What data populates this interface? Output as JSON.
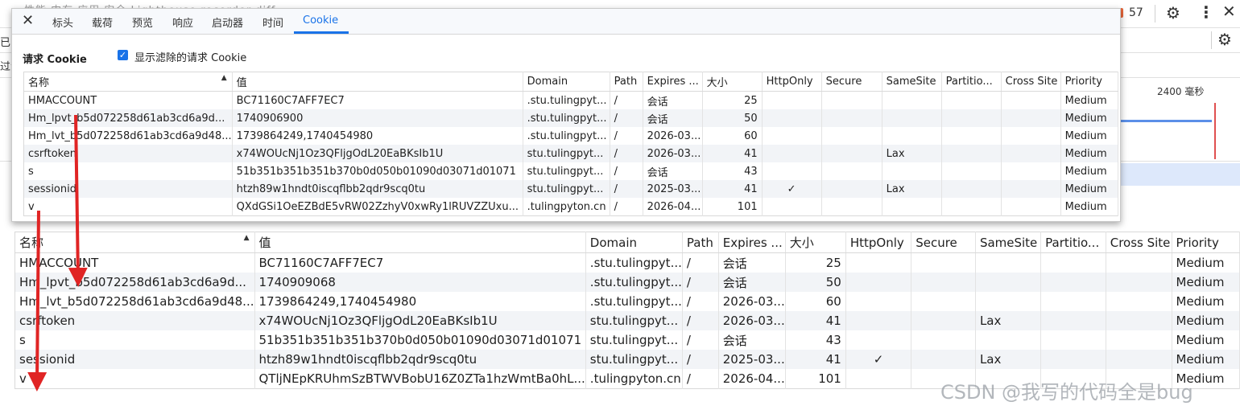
{
  "background": {
    "ghost_tabs": "性能   内存   应用   安全   Lighthouse   recorder   diff",
    "issue_count": "57",
    "row2_fragment": "已",
    "row3_fragment": "过滤",
    "timeline_label": "2400 毫秒"
  },
  "popup": {
    "tabs": [
      "标头",
      "载荷",
      "预览",
      "响应",
      "启动器",
      "时间",
      "Cookie"
    ],
    "active_tab": "Cookie",
    "section_title": "请求 Cookie",
    "checkbox_label": "显示滤除的请求 Cookie",
    "checkbox_checked": true,
    "columns": [
      "名称",
      "值",
      "Domain",
      "Path",
      "Expires ...",
      "大小",
      "HttpOnly",
      "Secure",
      "SameSite",
      "Partitio...",
      "Cross Site",
      "Priority"
    ],
    "rows": [
      {
        "name": "HMACCOUNT",
        "value": "BC71160C7AFF7EC7",
        "domain": ".stu.tulingpyt...",
        "path": "/",
        "expires": "会话",
        "size": "25",
        "httponly": "",
        "secure": "",
        "samesite": "",
        "partition": "",
        "cross_site": "",
        "priority": "Medium"
      },
      {
        "name": "Hm_lpvt_b5d072258d61ab3cd6a9d...",
        "value": "1740906900",
        "domain": ".stu.tulingpyt...",
        "path": "/",
        "expires": "会话",
        "size": "50",
        "httponly": "",
        "secure": "",
        "samesite": "",
        "partition": "",
        "cross_site": "",
        "priority": "Medium"
      },
      {
        "name": "Hm_lvt_b5d072258d61ab3cd6a9d48...",
        "value": "1739864249,1740454980",
        "domain": ".stu.tulingpyt...",
        "path": "/",
        "expires": "2026-03...",
        "size": "60",
        "httponly": "",
        "secure": "",
        "samesite": "",
        "partition": "",
        "cross_site": "",
        "priority": "Medium"
      },
      {
        "name": "csrftoken",
        "value": "x74WOUcNj1Oz3QFljgOdL20EaBKsIb1U",
        "domain": "stu.tulingpyt...",
        "path": "/",
        "expires": "2026-03...",
        "size": "41",
        "httponly": "",
        "secure": "",
        "samesite": "Lax",
        "partition": "",
        "cross_site": "",
        "priority": "Medium"
      },
      {
        "name": "s",
        "value": "51b351b351b351b370b0d050b01090d03071d01071",
        "domain": "stu.tulingpyt...",
        "path": "/",
        "expires": "会话",
        "size": "43",
        "httponly": "",
        "secure": "",
        "samesite": "",
        "partition": "",
        "cross_site": "",
        "priority": "Medium"
      },
      {
        "name": "sessionid",
        "value": "htzh89w1hndt0iscqflbb2qdr9scq0tu",
        "domain": "stu.tulingpyt...",
        "path": "/",
        "expires": "2025-03...",
        "size": "41",
        "httponly": "✓",
        "secure": "",
        "samesite": "Lax",
        "partition": "",
        "cross_site": "",
        "priority": "Medium"
      },
      {
        "name": "v",
        "value": "QXdGSi1OeEZBdE5vRW02ZzhyV0xwRy1lRUVZZUxu...",
        "domain": ".tulingpyton.cn",
        "path": "/",
        "expires": "2026-04...",
        "size": "101",
        "httponly": "",
        "secure": "",
        "samesite": "",
        "partition": "",
        "cross_site": "",
        "priority": "Medium"
      }
    ]
  },
  "bottom_table": {
    "columns": [
      "名称",
      "值",
      "Domain",
      "Path",
      "Expires ...",
      "大小",
      "HttpOnly",
      "Secure",
      "SameSite",
      "Partitio...",
      "Cross Site",
      "Priority"
    ],
    "rows": [
      {
        "name": "HMACCOUNT",
        "value": "BC71160C7AFF7EC7",
        "domain": ".stu.tulingpyt...",
        "path": "/",
        "expires": "会话",
        "size": "25",
        "httponly": "",
        "secure": "",
        "samesite": "",
        "partition": "",
        "cross_site": "",
        "priority": "Medium"
      },
      {
        "name": "Hm_lpvt_b5d072258d61ab3cd6a9d...",
        "value": "1740909068",
        "domain": ".stu.tulingpyt...",
        "path": "/",
        "expires": "会话",
        "size": "50",
        "httponly": "",
        "secure": "",
        "samesite": "",
        "partition": "",
        "cross_site": "",
        "priority": "Medium"
      },
      {
        "name": "Hm_lvt_b5d072258d61ab3cd6a9d48...",
        "value": "1739864249,1740454980",
        "domain": ".stu.tulingpyt...",
        "path": "/",
        "expires": "2026-03...",
        "size": "60",
        "httponly": "",
        "secure": "",
        "samesite": "",
        "partition": "",
        "cross_site": "",
        "priority": "Medium"
      },
      {
        "name": "csrftoken",
        "value": "x74WOUcNj1Oz3QFljgOdL20EaBKsIb1U",
        "domain": "stu.tulingpyt...",
        "path": "/",
        "expires": "2026-03...",
        "size": "41",
        "httponly": "",
        "secure": "",
        "samesite": "Lax",
        "partition": "",
        "cross_site": "",
        "priority": "Medium"
      },
      {
        "name": "s",
        "value": "51b351b351b351b370b0d050b01090d03071d01071",
        "domain": "stu.tulingpyt...",
        "path": "/",
        "expires": "会话",
        "size": "43",
        "httponly": "",
        "secure": "",
        "samesite": "",
        "partition": "",
        "cross_site": "",
        "priority": "Medium"
      },
      {
        "name": "sessionid",
        "value": "htzh89w1hndt0iscqflbb2qdr9scq0tu",
        "domain": "stu.tulingpyt...",
        "path": "/",
        "expires": "2025-03...",
        "size": "41",
        "httponly": "✓",
        "secure": "",
        "samesite": "Lax",
        "partition": "",
        "cross_site": "",
        "priority": "Medium"
      },
      {
        "name": "v",
        "value": "QTljNEpKRUhmSzBTWVBobU16Z0ZTa1hzWmtBa0hL...",
        "domain": ".tulingpyton.cn",
        "path": "/",
        "expires": "2026-04...",
        "size": "101",
        "httponly": "",
        "secure": "",
        "samesite": "",
        "partition": "",
        "cross_site": "",
        "priority": "Medium"
      }
    ]
  },
  "watermark": "CSDN @我写的代码全是bug",
  "colors": {
    "accent": "#1a73e8",
    "annotation_arrow": "#e02424",
    "row_alt": "#f2f4f7"
  }
}
